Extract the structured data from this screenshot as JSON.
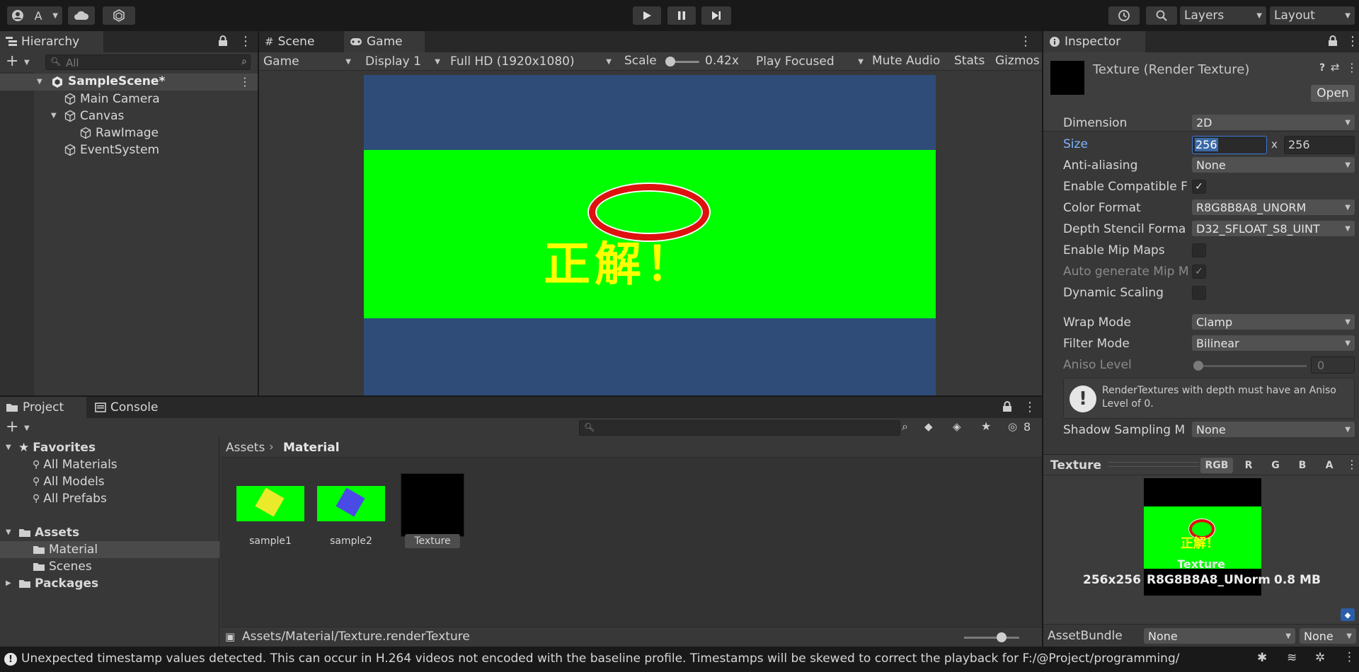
{
  "toolbar": {
    "account_label": "A",
    "layers_label": "Layers",
    "layout_label": "Layout"
  },
  "hierarchy": {
    "tab": "Hierarchy",
    "search_placeholder": "All",
    "scene": "SampleScene*",
    "items": [
      "Main Camera",
      "Canvas",
      "RawImage",
      "EventSystem"
    ]
  },
  "game": {
    "tabs": [
      "Scene",
      "Game"
    ],
    "display_mode": "Game",
    "display": "Display 1",
    "resolution": "Full HD (1920x1080)",
    "scale_label": "Scale",
    "scale_value": "0.42x",
    "play_mode": "Play Focused",
    "mute": "Mute Audio",
    "stats": "Stats",
    "gizmos": "Gizmos",
    "overlay_text": "正解！",
    "colors": {
      "bg": "#2f4c79",
      "band": "#00ff00",
      "ring": "#e01010",
      "text": "#ffff00"
    }
  },
  "project": {
    "tabs": [
      "Project",
      "Console"
    ],
    "favorites_label": "Favorites",
    "favorites": [
      "All Materials",
      "All Models",
      "All Prefabs"
    ],
    "assets_label": "Assets",
    "assets_children": [
      "Material",
      "Scenes"
    ],
    "packages_label": "Packages",
    "breadcrumb_root": "Assets",
    "breadcrumb_current": "Material",
    "assets": [
      "sample1",
      "sample2",
      "Texture"
    ],
    "hidden_count": "8",
    "footer_path": "Assets/Material/Texture.renderTexture"
  },
  "inspector": {
    "tab": "Inspector",
    "title": "Texture (Render Texture)",
    "open_button": "Open",
    "labels": {
      "dimension": "Dimension",
      "size": "Size",
      "aa": "Anti-aliasing",
      "compat": "Enable Compatible F",
      "color_format": "Color Format",
      "depth": "Depth Stencil Forma",
      "mips": "Enable Mip Maps",
      "auto_mip": "Auto generate Mip M",
      "dynamic": "Dynamic Scaling",
      "wrap": "Wrap Mode",
      "filter": "Filter Mode",
      "aniso": "Aniso Level",
      "shadow": "Shadow Sampling M"
    },
    "values": {
      "dimension": "2D",
      "width": "256",
      "x": "x",
      "height": "256",
      "aa": "None",
      "color_format": "R8G8B8A8_UNORM",
      "depth": "D32_SFLOAT_S8_UINT",
      "wrap": "Clamp",
      "filter": "Bilinear",
      "aniso": "0",
      "shadow": "None"
    },
    "warning": "RenderTextures with depth must have an Aniso Level of 0.",
    "preview": {
      "label": "Texture",
      "channels": [
        "RGB",
        "R",
        "G",
        "B",
        "A"
      ],
      "name": "Texture",
      "dims": "256x256",
      "format": "R8G8B8A8_UNorm",
      "size": "0.8 MB"
    },
    "assetbundle": {
      "label": "AssetBundle",
      "value1": "None",
      "value2": "None"
    }
  },
  "status": {
    "message": "Unexpected timestamp values detected. This can occur in H.264 videos not encoded with the baseline profile. Timestamps will be skewed to correct the playback for F:/@Project/programming/"
  }
}
